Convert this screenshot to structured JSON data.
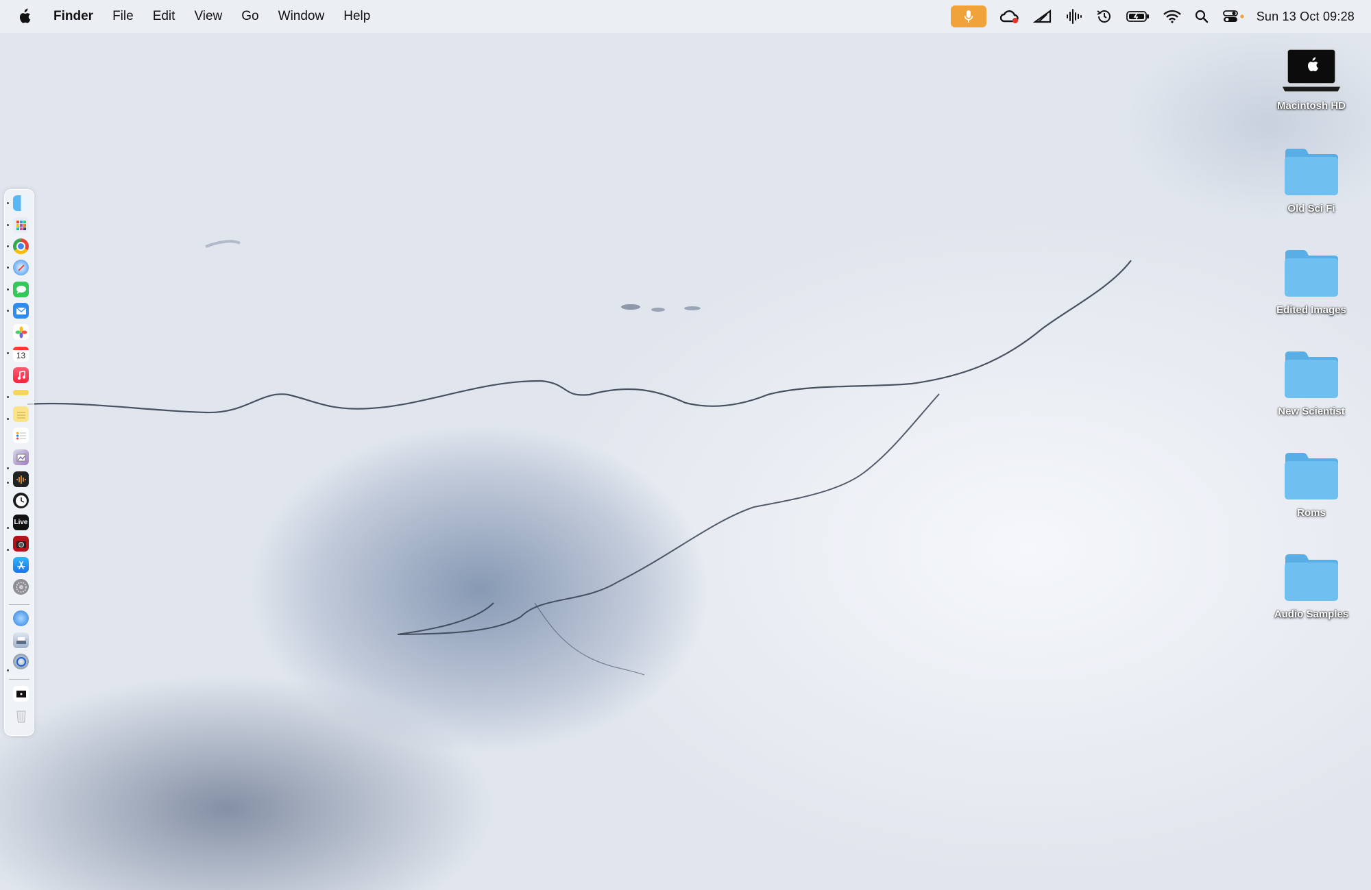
{
  "menubar": {
    "app_name": "Finder",
    "menus": [
      "File",
      "Edit",
      "View",
      "Go",
      "Window",
      "Help"
    ],
    "clock": "Sun 13 Oct  09:28",
    "status_icons": [
      "microphone-icon",
      "creative-cloud-icon",
      "wedge-icon",
      "audio-waveform-icon",
      "time-machine-icon",
      "battery-icon",
      "wifi-icon",
      "spotlight-search-icon",
      "control-center-icon"
    ],
    "mic_color": "#f0a33a"
  },
  "dock": {
    "apps": [
      {
        "name": "finder-icon",
        "running": true
      },
      {
        "name": "launchpad-icon",
        "running": false
      },
      {
        "name": "chrome-icon",
        "running": true
      },
      {
        "name": "safari-icon",
        "running": true
      },
      {
        "name": "messages-icon",
        "running": true
      },
      {
        "name": "mail-icon",
        "running": true
      },
      {
        "name": "photos-icon",
        "running": true
      },
      {
        "name": "calendar-icon",
        "running": false,
        "text": "13"
      },
      {
        "name": "music-icon",
        "running": true
      },
      {
        "name": "notes-strip-icon",
        "running": true
      },
      {
        "name": "notes-icon",
        "running": true
      },
      {
        "name": "reminders-icon",
        "running": false
      },
      {
        "name": "preview-icon",
        "running": true
      },
      {
        "name": "audio-app-icon",
        "running": true
      },
      {
        "name": "clock-icon",
        "running": false
      },
      {
        "name": "ableton-live-icon",
        "running": true,
        "text": "Live"
      },
      {
        "name": "photo-booth-icon",
        "running": true
      },
      {
        "name": "app-store-icon",
        "running": false
      },
      {
        "name": "system-settings-icon",
        "running": false
      },
      {
        "name": "network-icon",
        "running": false
      },
      {
        "name": "disk-utility-icon",
        "running": false
      },
      {
        "name": "quicktime-icon",
        "running": true
      },
      {
        "name": "screen-icon",
        "running": false
      },
      {
        "name": "trash-icon",
        "running": false
      }
    ]
  },
  "desktop": {
    "items": [
      {
        "label": "Macintosh HD",
        "kind": "drive"
      },
      {
        "label": "Old Sci Fi",
        "kind": "folder"
      },
      {
        "label": "Edited Images",
        "kind": "folder"
      },
      {
        "label": "New Scientist",
        "kind": "folder"
      },
      {
        "label": "Roms",
        "kind": "folder"
      },
      {
        "label": "Audio Samples",
        "kind": "folder"
      }
    ]
  },
  "colors": {
    "folder_blue": "#6fbff0",
    "folder_tab": "#5aaee6"
  }
}
